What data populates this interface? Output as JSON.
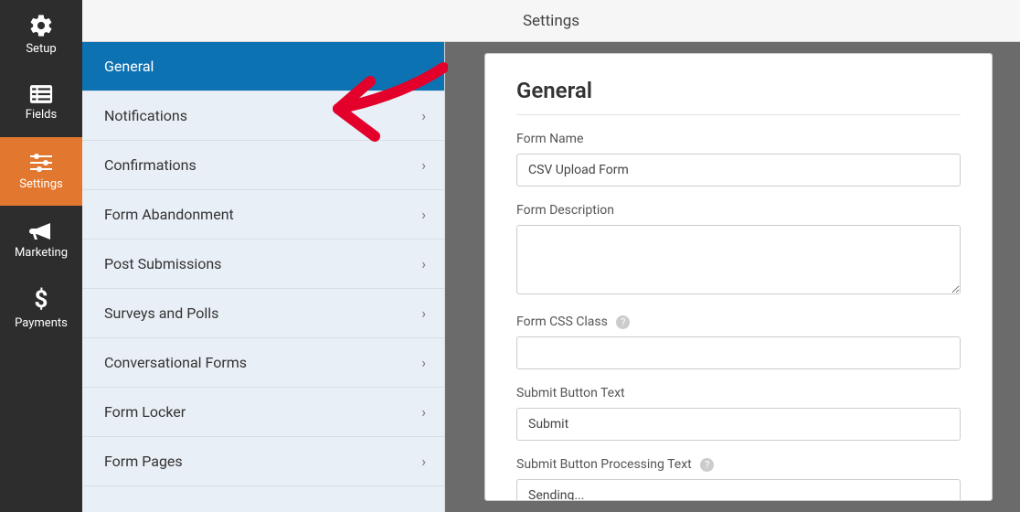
{
  "header": {
    "title": "Settings"
  },
  "iconSidebar": {
    "items": [
      {
        "name": "setup",
        "label": "Setup"
      },
      {
        "name": "fields",
        "label": "Fields"
      },
      {
        "name": "settings",
        "label": "Settings"
      },
      {
        "name": "marketing",
        "label": "Marketing"
      },
      {
        "name": "payments",
        "label": "Payments"
      }
    ]
  },
  "settingsNav": {
    "items": [
      {
        "label": "General",
        "active": true
      },
      {
        "label": "Notifications",
        "active": false
      },
      {
        "label": "Confirmations",
        "active": false
      },
      {
        "label": "Form Abandonment",
        "active": false
      },
      {
        "label": "Post Submissions",
        "active": false
      },
      {
        "label": "Surveys and Polls",
        "active": false
      },
      {
        "label": "Conversational Forms",
        "active": false
      },
      {
        "label": "Form Locker",
        "active": false
      },
      {
        "label": "Form Pages",
        "active": false
      }
    ]
  },
  "form": {
    "heading": "General",
    "fields": {
      "formName": {
        "label": "Form Name",
        "value": "CSV Upload Form"
      },
      "formDescription": {
        "label": "Form Description",
        "value": ""
      },
      "formCssClass": {
        "label": "Form CSS Class",
        "value": "",
        "help": true
      },
      "submitText": {
        "label": "Submit Button Text",
        "value": "Submit"
      },
      "submitProcessing": {
        "label": "Submit Button Processing Text",
        "value": "Sending...",
        "help": true
      }
    }
  }
}
